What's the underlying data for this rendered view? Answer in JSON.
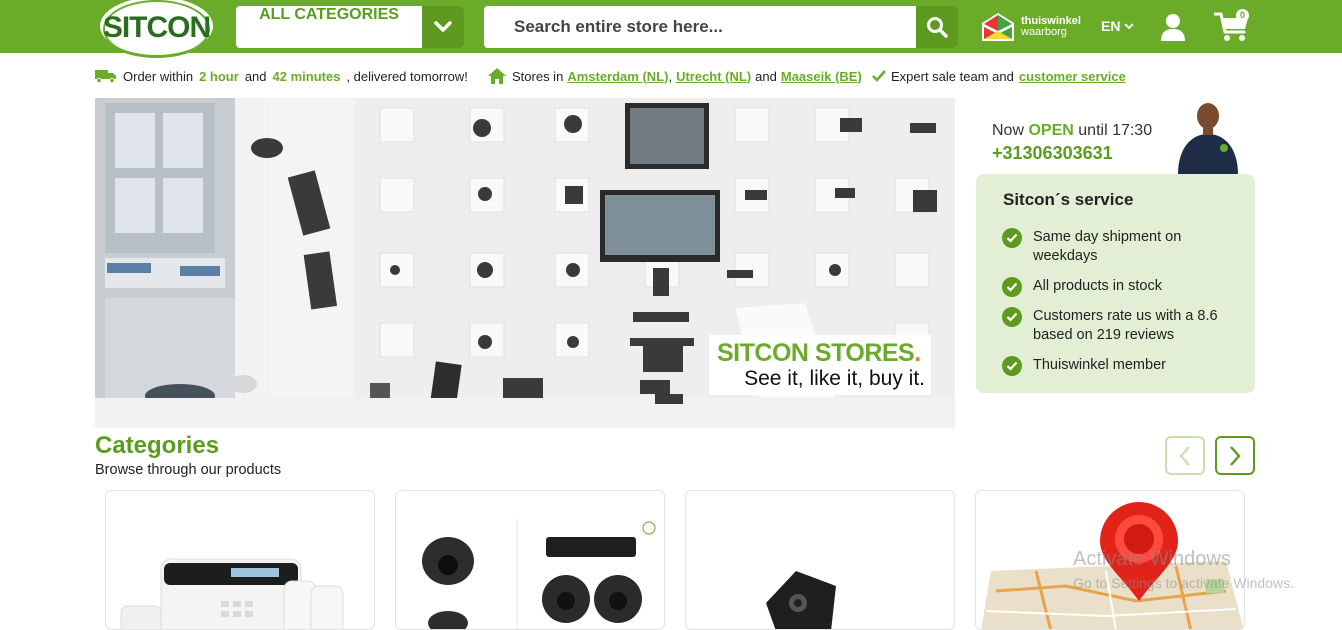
{
  "brand": {
    "logo_text": "SITCON",
    "accent": "#6aac2a",
    "dark_accent": "#5e9a20"
  },
  "header": {
    "categories_label": "ALL CATEGORIES",
    "search_placeholder": "Search entire store here...",
    "thuiswinkel_line1": "thuiswinkel",
    "thuiswinkel_line2": "waarborg",
    "language": "EN",
    "cart_count": "0"
  },
  "usps": {
    "delivery_pre": "Order within",
    "delivery_hours": "2 hour",
    "delivery_and": "and",
    "delivery_minutes": "42 minutes",
    "delivery_post": ", delivered tomorrow!",
    "stores_pre": "Stores in",
    "store_1": "Amsterdam (NL)",
    "store_sep": ",",
    "store_2": "Utrecht (NL)",
    "store_and": "and",
    "store_3": "Maaseik (BE)",
    "expert_pre": "Expert sale team and",
    "expert_link": "customer service"
  },
  "banner": {
    "stores_title": "SITCON STORES",
    "stores_dot": ".",
    "stores_slogan": "See it, like it, buy it."
  },
  "contact": {
    "now": "Now",
    "open": "OPEN",
    "until": "until 17:30",
    "phone": "+31306303631"
  },
  "service": {
    "title": "Sitcon´s service",
    "items": [
      "Same day shipment on weekdays",
      "All products in stock",
      "Customers rate us with a 8.6 based on 219 reviews",
      "Thuiswinkel member"
    ]
  },
  "categories": {
    "title": "Categories",
    "subtitle": "Browse through our products"
  },
  "watermark": {
    "line1": "Activate Windows",
    "line2": "Go to Settings to activate Windows."
  }
}
